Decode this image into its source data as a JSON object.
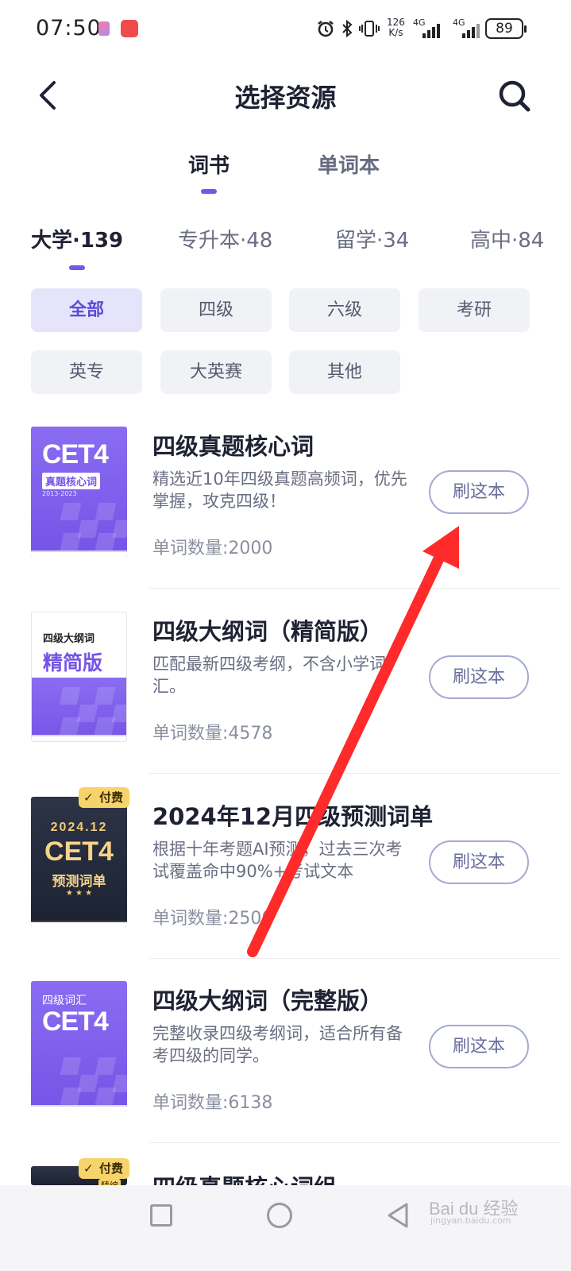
{
  "status_bar": {
    "time": "07:50",
    "speed_top": "126",
    "speed_bottom": "K/s",
    "net1": "4G",
    "net2": "4G",
    "battery": "89",
    "icons": [
      "alarm-icon",
      "bluetooth-icon",
      "vibrate-icon",
      "signal-icon",
      "battery-icon"
    ]
  },
  "nav": {
    "title": "选择资源",
    "back_icon": "chevron-left-icon",
    "search_icon": "search-icon"
  },
  "main_tabs": [
    {
      "label": "词书",
      "active": true
    },
    {
      "label": "单词本",
      "active": false
    }
  ],
  "category_tabs": [
    {
      "label": "大学·139",
      "active": true
    },
    {
      "label": "专升本·48",
      "active": false
    },
    {
      "label": "留学·34",
      "active": false
    },
    {
      "label": "高中·84",
      "active": false
    }
  ],
  "filters": [
    {
      "label": "全部",
      "active": true
    },
    {
      "label": "四级",
      "active": false
    },
    {
      "label": "六级",
      "active": false
    },
    {
      "label": "考研",
      "active": false
    },
    {
      "label": "英专",
      "active": false
    },
    {
      "label": "大英赛",
      "active": false
    },
    {
      "label": "其他",
      "active": false
    }
  ],
  "books": [
    {
      "title": "四级真题核心词",
      "desc": "精选近10年四级真题高频词，优先掌握，攻克四级！",
      "count": "单词数量:2000",
      "button": "刷这本",
      "cover": {
        "style": "purple",
        "big": "CET4",
        "tag": "真题核心词",
        "small": "2013-2023"
      }
    },
    {
      "title": "四级大纲词（精简版）",
      "desc": "匹配最新四级考纲，不含小学词汇。",
      "count": "单词数量:4578",
      "button": "刷这本",
      "cover": {
        "style": "white",
        "line1": "四级大纲词",
        "line2": "精简版"
      }
    },
    {
      "title": "2024年12月四级预测词单",
      "desc": "根据十年考题AI预测，过去三次考试覆盖命中90%+考试文本",
      "count": "单词数量:2500",
      "button": "刷这本",
      "badge": "付费",
      "cover": {
        "style": "dark",
        "line1": "2024.12",
        "big": "CET4",
        "line2": "预测词单"
      }
    },
    {
      "title": "四级大纲词（完整版）",
      "desc": "完整收录四级考纲词，适合所有备考四级的同学。",
      "count": "单词数量:6138",
      "button": "刷这本",
      "cover": {
        "style": "purple",
        "line1": "四级词汇",
        "big": "CET4"
      }
    },
    {
      "title": "四级真题核心词组",
      "badge": "付费",
      "badge2": "精编"
    }
  ],
  "watermark": {
    "text": "Bai du 经验",
    "sub": "jingyan.baidu.com"
  },
  "colors": {
    "accent": "#6c5ce7",
    "arrow": "#ff2a2a"
  }
}
